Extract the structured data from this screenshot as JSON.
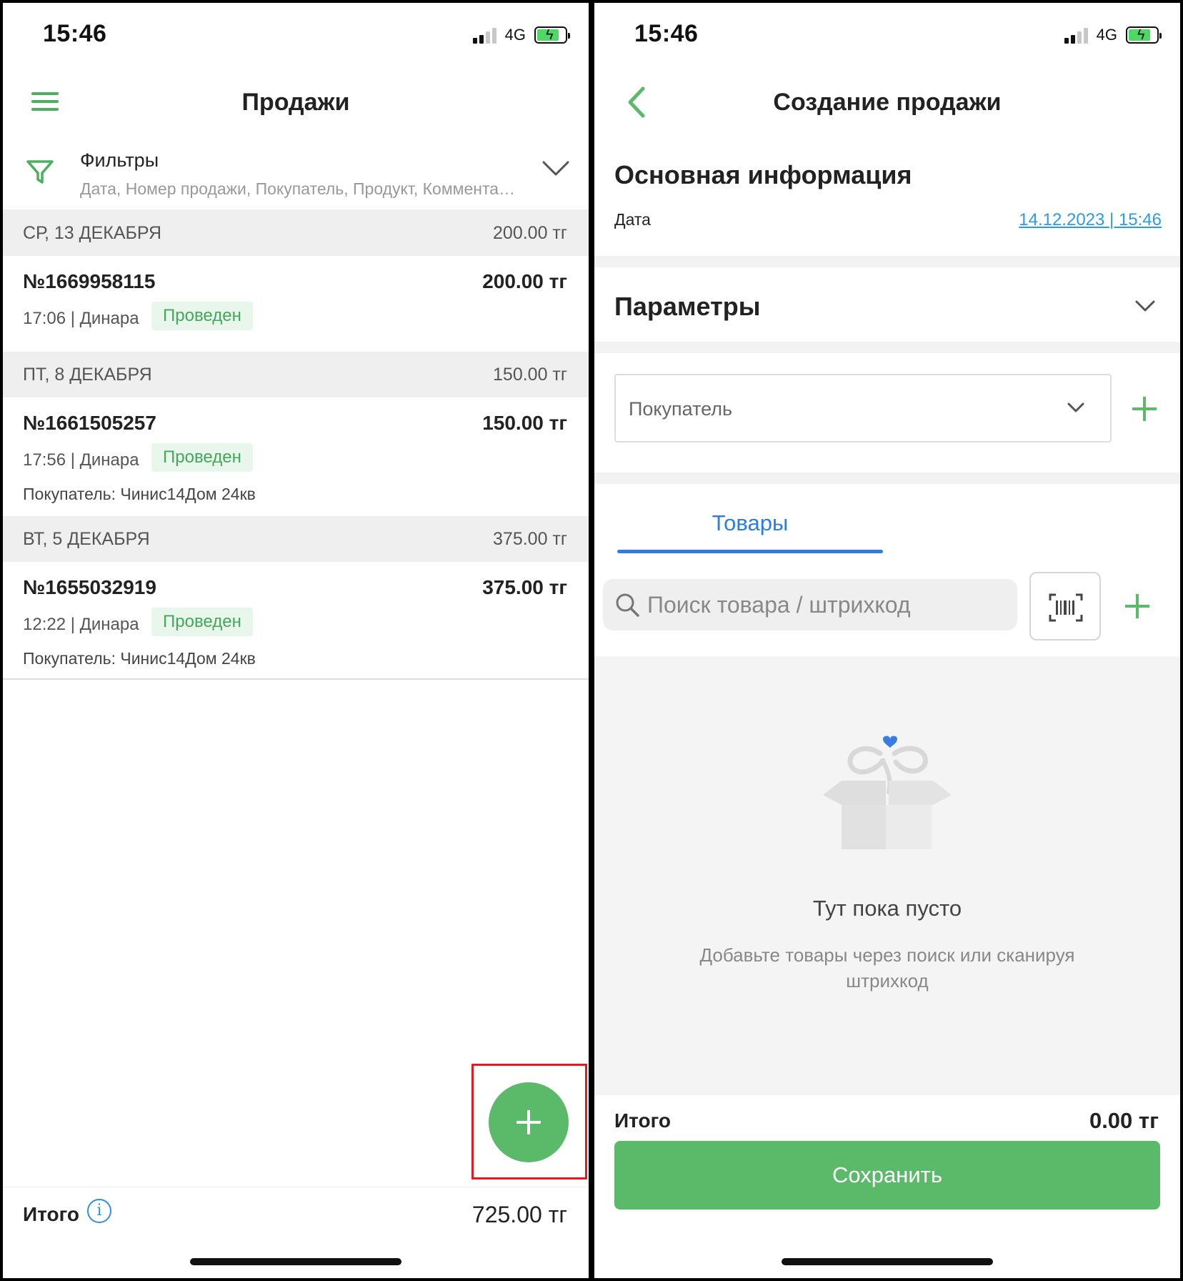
{
  "left": {
    "status": {
      "time": "15:46",
      "network": "4G"
    },
    "header": {
      "title": "Продажи"
    },
    "filters": {
      "title": "Фильтры",
      "summary": "Дата, Номер продажи, Покупатель, Продукт, Комментарий"
    },
    "days": [
      {
        "label": "СР, 13 ДЕКАБРЯ",
        "total": "200.00 тг",
        "sales": [
          {
            "number": "№1669958115",
            "amount": "200.00 тг",
            "meta": "17:06 | Динара",
            "status": "Проведен",
            "buyer": ""
          }
        ]
      },
      {
        "label": "ПТ, 8 ДЕКАБРЯ",
        "total": "150.00 тг",
        "sales": [
          {
            "number": "№1661505257",
            "amount": "150.00 тг",
            "meta": "17:56 | Динара",
            "status": "Проведен",
            "buyer": "Покупатель: Чинис14Дом 24кв"
          }
        ]
      },
      {
        "label": "ВТ, 5 ДЕКАБРЯ",
        "total": "375.00 тг",
        "sales": [
          {
            "number": "№1655032919",
            "amount": "375.00 тг",
            "meta": "12:22 | Динара",
            "status": "Проведен",
            "buyer": "Покупатель: Чинис14Дом 24кв"
          }
        ]
      }
    ],
    "footer": {
      "label": "Итого",
      "total": "725.00 тг"
    }
  },
  "right": {
    "status": {
      "time": "15:46",
      "network": "4G"
    },
    "header": {
      "title": "Создание продажи"
    },
    "main_info": {
      "title": "Основная информация",
      "date_label": "Дата",
      "date_value": "14.12.2023 | 15:46"
    },
    "params": {
      "title": "Параметры"
    },
    "buyer": {
      "placeholder": "Покупатель"
    },
    "tabs": [
      {
        "label": "Товары",
        "active": true
      }
    ],
    "search": {
      "placeholder": "Поиск товара / штрихкод"
    },
    "empty": {
      "title": "Тут пока пусто",
      "subtitle": "Добавьте товары через поиск или сканируя штрихкод"
    },
    "footer": {
      "label": "Итого",
      "total": "0.00 тг",
      "save_label": "Сохранить"
    }
  },
  "colors": {
    "accent_green": "#5bba6a",
    "status_green": "#43a85a",
    "link_blue": "#2e9bea",
    "tab_blue": "#2e7de0",
    "highlight_red": "#e01b24"
  }
}
